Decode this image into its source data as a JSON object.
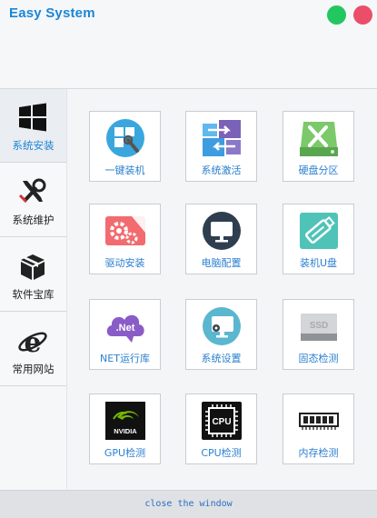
{
  "app": {
    "title": "Easy System"
  },
  "window_controls": {
    "minimize_color": "#22c760",
    "close_color": "#ec4d6b"
  },
  "sidebar": {
    "items": [
      {
        "label": "系统安装",
        "icon": "windows-logo-icon",
        "active": true
      },
      {
        "label": "系统维护",
        "icon": "tools-icon",
        "active": false
      },
      {
        "label": "软件宝库",
        "icon": "package-box-icon",
        "active": false
      },
      {
        "label": "常用网站",
        "icon": "internet-explorer-icon",
        "active": false
      }
    ]
  },
  "tiles": [
    {
      "label": "一键装机",
      "icon": "one-click-install-icon"
    },
    {
      "label": "系统激活",
      "icon": "system-activation-icon"
    },
    {
      "label": "硬盘分区",
      "icon": "disk-partition-icon"
    },
    {
      "label": "驱动安装",
      "icon": "driver-install-icon"
    },
    {
      "label": "电脑配置",
      "icon": "monitor-icon"
    },
    {
      "label": "装机U盘",
      "icon": "usb-drive-icon"
    },
    {
      "label": "NET运行库",
      "icon": "dotnet-cloud-icon",
      "icon_text": ".Net"
    },
    {
      "label": "系统设置",
      "icon": "settings-monitor-icon"
    },
    {
      "label": "固态检测",
      "icon": "ssd-icon",
      "icon_text": "SSD"
    },
    {
      "label": "GPU检测",
      "icon": "nvidia-logo-icon",
      "icon_text": "NVIDIA"
    },
    {
      "label": "CPU检测",
      "icon": "cpu-chip-icon",
      "icon_text": "CPU"
    },
    {
      "label": "内存检测",
      "icon": "ram-module-icon"
    }
  ],
  "footer": {
    "close_label": "close the window"
  },
  "colors": {
    "accent": "#1b86d6",
    "tile_label": "#2a7fcf"
  }
}
